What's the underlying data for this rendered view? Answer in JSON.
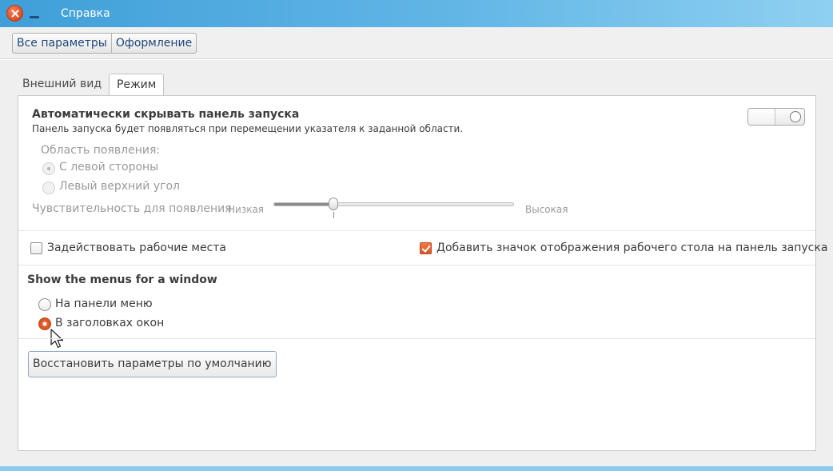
{
  "window": {
    "title": "Справка"
  },
  "toolbar": {
    "all_settings": "Все параметры",
    "appearance": "Оформление"
  },
  "tabs": [
    {
      "label": "Внешний вид"
    },
    {
      "label": "Режим"
    }
  ],
  "autohide": {
    "title": "Автоматически скрывать панель запуска",
    "description": "Панель запуска будет появляться при перемещении указателя к заданной области.",
    "enabled": false,
    "reveal_area_label": "Область появления:",
    "options": [
      {
        "label": "С левой стороны",
        "selected": true
      },
      {
        "label": "Левый верхний угол",
        "selected": false
      }
    ],
    "sensitivity_label": "Чувствительность для появления",
    "sensitivity_low": "Низкая",
    "sensitivity_high": "Высокая",
    "sensitivity_value": 0.25
  },
  "workspaces": {
    "label": "Задействовать рабочие места",
    "checked": false
  },
  "show_desktop": {
    "label": "Добавить значок отображения рабочего стола на панель запуска",
    "checked": true
  },
  "menus": {
    "title": "Show the menus for a window",
    "options": [
      {
        "label": "На панели меню",
        "selected": false
      },
      {
        "label": "В заголовках окон",
        "selected": true
      }
    ]
  },
  "restore_button": "Восстановить параметры по умолчанию",
  "colors": {
    "accent": "#dd5a26",
    "titlebar": "#4aa6dc",
    "link": "#1e4778"
  }
}
